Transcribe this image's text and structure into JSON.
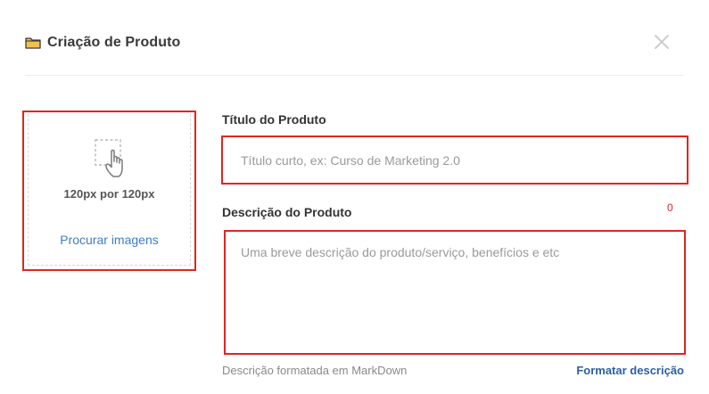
{
  "header": {
    "icon": "folder-icon",
    "title": "Criação de Produto",
    "close_icon": "close-icon"
  },
  "uploader": {
    "icon": "hand-pointer-icon",
    "size_label": "120px por 120px",
    "browse_label": "Procurar imagens"
  },
  "form": {
    "title_label": "Título do Produto",
    "title_value": "",
    "title_placeholder": "Título curto, ex: Curso de Marketing 2.0",
    "description_label": "Descrição do Produto",
    "description_counter": "0",
    "description_value": "",
    "description_placeholder": "Uma breve descrição do produto/serviço, benefícios e etc",
    "markdown_hint": "Descrição formatada em MarkDown",
    "format_link_label": "Formatar descrição"
  },
  "colors": {
    "highlight": "#e0261f",
    "link": "#3d7cc9",
    "link_strong": "#2d5fa3",
    "folder": "#f2c04e"
  }
}
